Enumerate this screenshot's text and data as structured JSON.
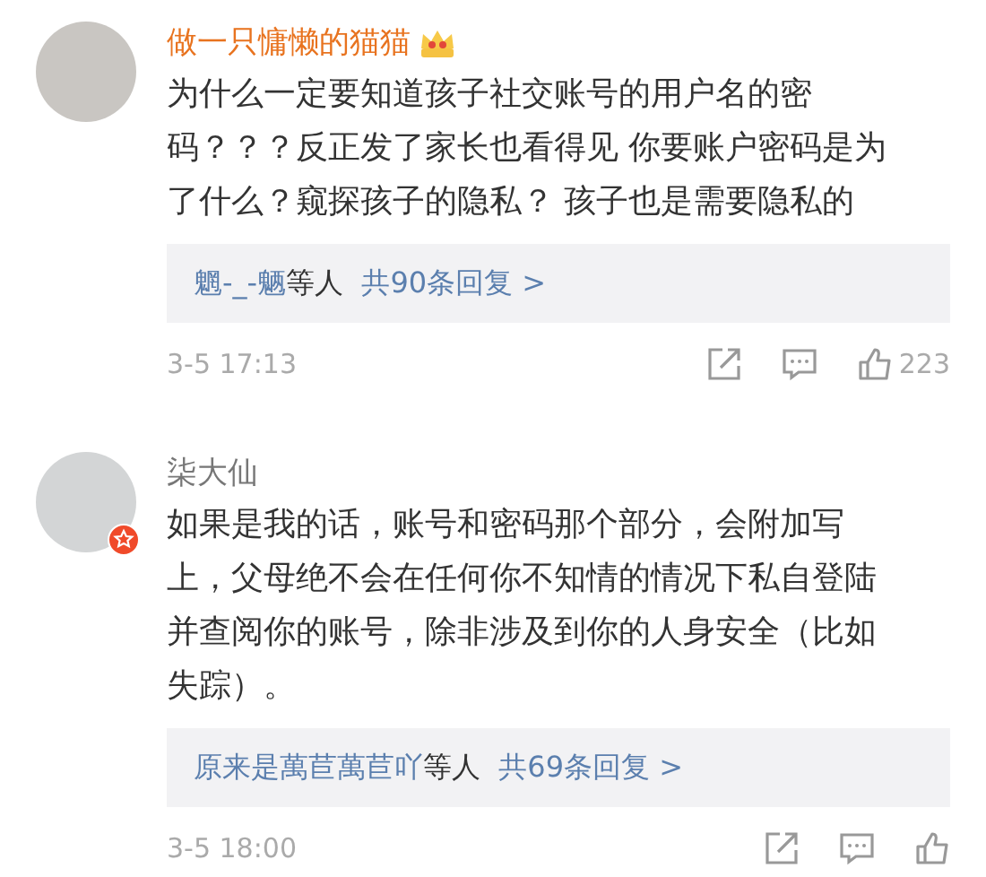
{
  "comments": [
    {
      "user": {
        "name": "做一只慵懒的猫猫",
        "vip": true,
        "verified": false
      },
      "text": "为什么一定要知道孩子社交账号的用户名的密码？？？反正发了家长也看得见 你要账户密码是为了什么？窥探孩子的隐私？ 孩子也是需要隐私的",
      "replies": {
        "users": "魍-_-魉",
        "suffix": "等人",
        "count": "共90条回复 >"
      },
      "time": "3-5 17:13",
      "likes": "223"
    },
    {
      "user": {
        "name": "柒大仙",
        "vip": false,
        "verified": true
      },
      "text": "如果是我的话，账号和密码那个部分，会附加写上，父母绝不会在任何你不知情的情况下私自登陆并查阅你的账号，除非涉及到你的人身安全（比如失踪）。",
      "replies": {
        "users": "原来是萬苣萬苣吖",
        "suffix": "等人",
        "count": "共69条回复 >"
      },
      "time": "3-5 18:00"
    }
  ]
}
